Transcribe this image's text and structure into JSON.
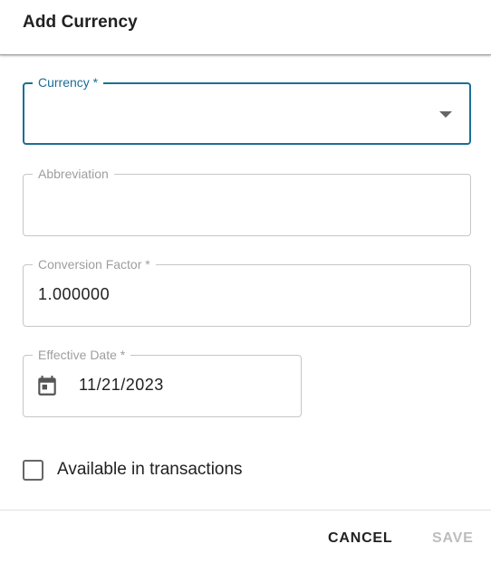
{
  "dialog": {
    "title": "Add Currency"
  },
  "fields": {
    "currency": {
      "label": "Currency *",
      "value": ""
    },
    "abbreviation": {
      "label": "Abbreviation",
      "value": ""
    },
    "conversion_factor": {
      "label": "Conversion Factor *",
      "value": "1.000000"
    },
    "effective_date": {
      "label": "Effective Date *",
      "value": "11/21/2023"
    }
  },
  "checkbox": {
    "label": "Available in transactions",
    "checked": false
  },
  "actions": {
    "cancel_label": "CANCEL",
    "save_label": "SAVE"
  },
  "colors": {
    "accent": "#1a6e96",
    "border": "#c6c6c6",
    "disabled": "#bdbdbd"
  },
  "icons": {
    "dropdown": "arrow-drop-down-icon",
    "date": "calendar-icon"
  }
}
